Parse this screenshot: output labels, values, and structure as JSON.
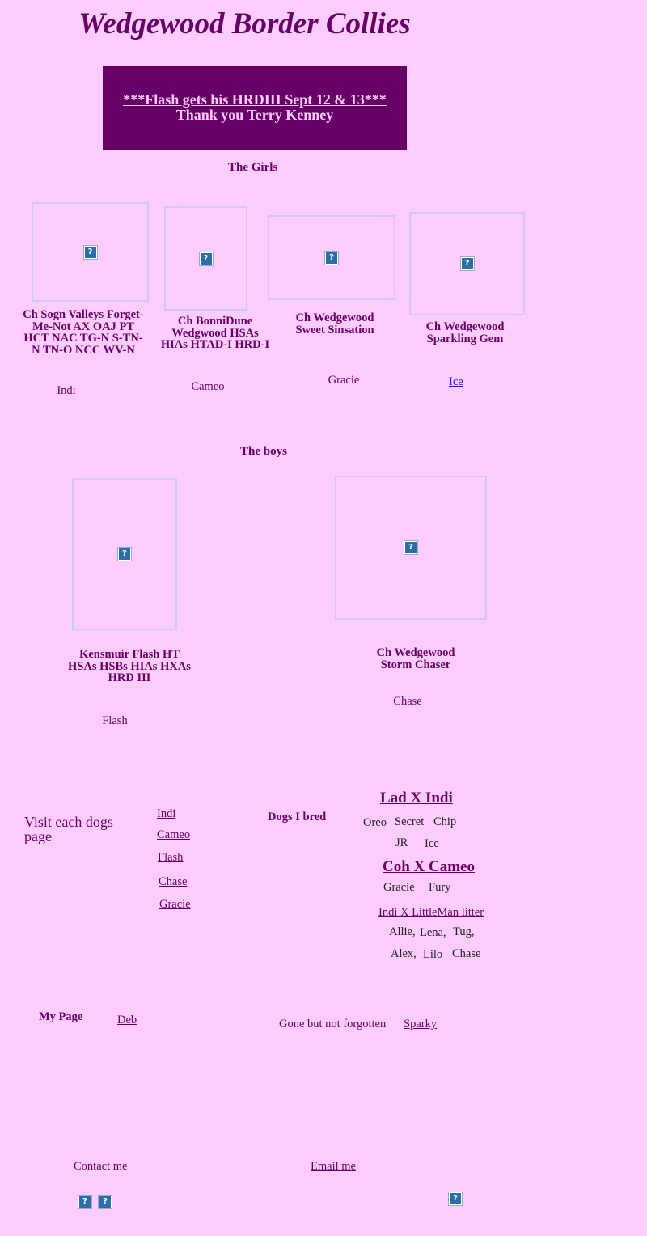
{
  "page_title": "Wedgewood Border Collies",
  "banner": {
    "line1": "***Flash gets his HRDIII Sept 12 & 13***",
    "line2": "Thank  you Terry Kenney"
  },
  "girls": {
    "heading": "The Girls",
    "dogs": [
      {
        "caption": "Ch Sogn Valleys Forget-Me-Not AX OAJ PT HCT  NAC TG-N S-TN-N TN-O NCC WV-N",
        "name": "Indi"
      },
      {
        "caption": "Ch BonniDune Wedgwood HSAs HIAs HTAD-I HRD-I",
        "name": "Cameo"
      },
      {
        "caption": "Ch Wedgewood Sweet Sinsation",
        "name": "Gracie"
      },
      {
        "caption": "Ch Wedgewood Sparkling Gem",
        "name": "Ice"
      }
    ]
  },
  "boys": {
    "heading": "The boys",
    "dogs": [
      {
        "caption": "Kensmuir Flash HT HSAs HSBs HIAs HXAs HRD III",
        "name": "Flash"
      },
      {
        "caption": "Ch Wedgewood Storm Chaser",
        "name": "Chase"
      }
    ]
  },
  "visit": {
    "label": "Visit each dogs page",
    "links": [
      "Indi",
      "Cameo",
      "Flash",
      "Chase",
      "Gracie"
    ]
  },
  "bred": {
    "label": "Dogs I bred",
    "litter1": {
      "title": "Lad X Indi",
      "pups_row1": [
        "Oreo",
        "Secret",
        "Chip"
      ],
      "pups_row2": [
        "JR",
        "Ice"
      ]
    },
    "litter2": {
      "title": "Coh X Cameo",
      "pups": [
        "Gracie",
        "Fury"
      ]
    },
    "litter3": {
      "title": "Indi X LittleMan litter",
      "row1": [
        "Allie,",
        "Lena,",
        "Tug,"
      ],
      "row2": [
        "Alex,",
        "Lilo",
        "Chase"
      ]
    }
  },
  "my_page": {
    "label": "My Page",
    "link": "Deb"
  },
  "memorial": {
    "label": "Gone but not forgotten",
    "link": "Sparky"
  },
  "contact": {
    "label": "Contact me",
    "email_link": "Email me"
  },
  "placeholder_glyph": "?"
}
